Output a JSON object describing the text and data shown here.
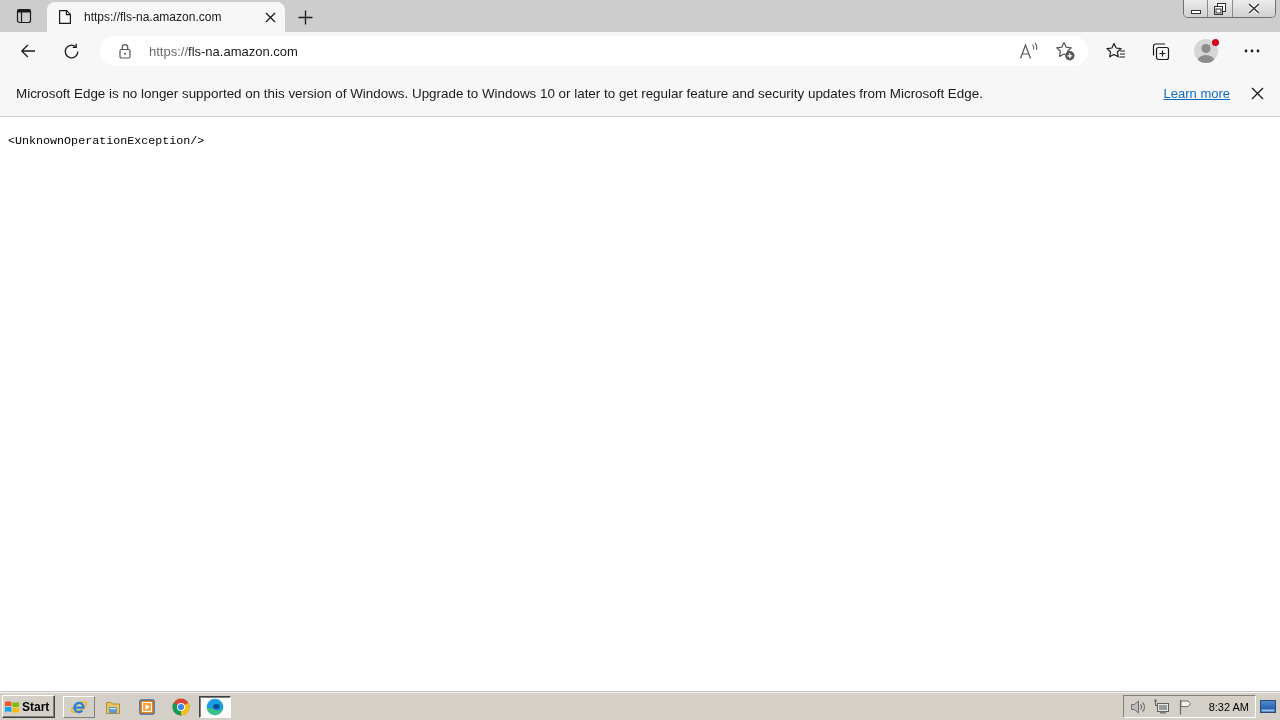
{
  "tabs": [
    {
      "title": "https://fls-na.amazon.com",
      "selected": true
    }
  ],
  "address_bar": {
    "scheme": "https://",
    "host": "fls-na.amazon.com"
  },
  "profile": {
    "notification": true
  },
  "infobar": {
    "message": "Microsoft Edge is no longer supported on this version of Windows. Upgrade to Windows 10 or later to get regular feature and security updates from Microsoft Edge.",
    "link": "Learn more"
  },
  "page": {
    "text": "<UnknownOperationException/>"
  },
  "taskbar": {
    "start": "Start",
    "apps": [
      {
        "hovered": true,
        "selected": false
      },
      {
        "hovered": false,
        "selected": false
      },
      {
        "hovered": false,
        "selected": false
      },
      {
        "hovered": false,
        "selected": false
      },
      {
        "hovered": false,
        "selected": true
      }
    ],
    "clock": "8:32 AM"
  }
}
